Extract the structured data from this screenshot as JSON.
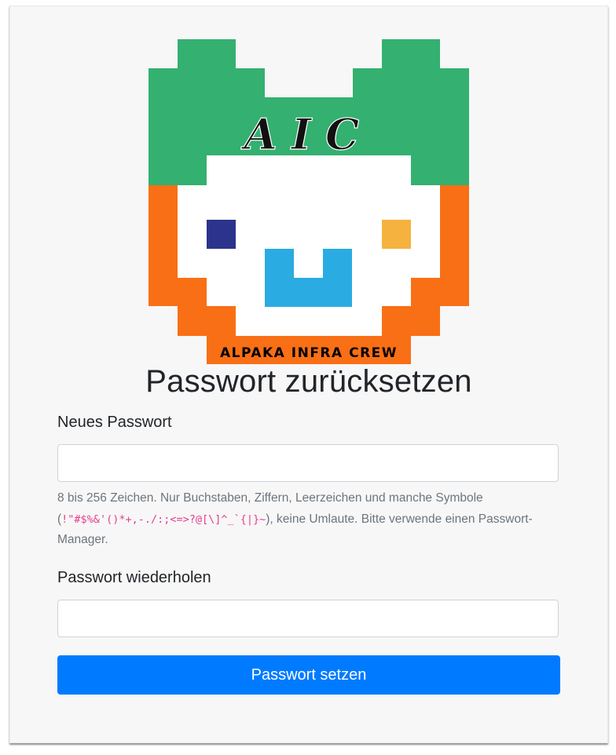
{
  "logo": {
    "name": "aic-logo",
    "top_text": "AIC",
    "bottom_text": "ALPAKA INFRA CREW",
    "colors": {
      "green": "#34b070",
      "orange": "#f96f16",
      "white": "#ffffff",
      "navy": "#2b338c",
      "amber": "#f6b23e",
      "blue": "#2aabe2"
    }
  },
  "page": {
    "title": "Passwort zurücksetzen"
  },
  "form": {
    "new_password": {
      "label": "Neues Passwort",
      "value": "",
      "placeholder": ""
    },
    "help_text_before": "8 bis 256 Zeichen. Nur Buchstaben, Ziffern, Leerzeichen und manche Symbole (",
    "help_symbols": "!\"#$%&'()*+,-./:;<=>?@[\\]^_`{|}~",
    "help_text_after": "), keine Umlaute. Bitte verwende einen Passwort-Manager.",
    "repeat_password": {
      "label": "Passwort wiederholen",
      "value": "",
      "placeholder": ""
    },
    "submit_label": "Passwort setzen"
  },
  "theme": {
    "primary": "#007bff",
    "card_background": "#f7f7f7",
    "help_text": "#6c757d",
    "code": "#e83e8c"
  }
}
